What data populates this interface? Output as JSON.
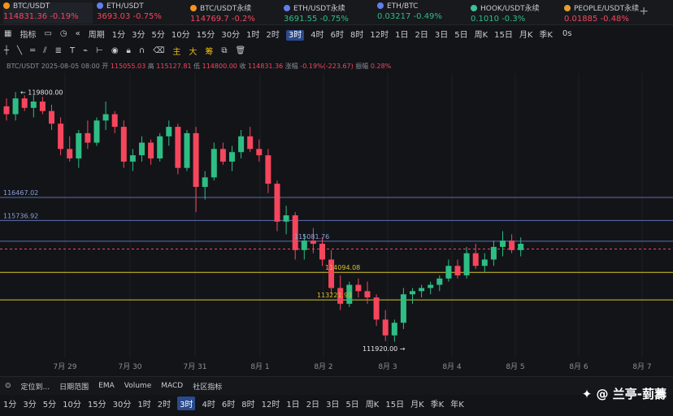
{
  "tickers": [
    {
      "name": "BTC/USDT",
      "price": "114831.36",
      "change": "-0.19%",
      "dir": "dn",
      "color": "#f7931a",
      "active": true
    },
    {
      "name": "ETH/USDT",
      "price": "3693.03",
      "change": "-0.75%",
      "dir": "dn",
      "color": "#627eea"
    },
    {
      "name": "BTC/USDT永续",
      "price": "114769.7",
      "change": "-0.2%",
      "dir": "dn",
      "color": "#f7931a"
    },
    {
      "name": "ETH/USDT永续",
      "price": "3691.55",
      "change": "-0.75%",
      "dir": "up",
      "color": "#627eea"
    },
    {
      "name": "ETH/BTC",
      "price": "0.03217",
      "change": "-0.49%",
      "dir": "up",
      "color": "#627eea"
    },
    {
      "name": "HOOK/USDT永续",
      "price": "0.1010",
      "change": "-0.3%",
      "dir": "up",
      "color": "#3fbfa0"
    },
    {
      "name": "PEOPLE/USDT永续",
      "price": "0.01885",
      "change": "-0.48%",
      "dir": "dn",
      "color": "#e0a030"
    }
  ],
  "toolbar": {
    "indicators": "指标",
    "period": "周期",
    "timeframes": [
      "1分",
      "3分",
      "5分",
      "10分",
      "15分",
      "30分",
      "1时",
      "2时",
      "3时",
      "4时",
      "6时",
      "8时",
      "12时",
      "1日",
      "2日",
      "3日",
      "5日",
      "周K",
      "15日",
      "月K",
      "季K",
      "年K"
    ],
    "selected": "3时",
    "right_label": "0s"
  },
  "draw_tools": {
    "main": "主",
    "big": "大",
    "chip": "筹"
  },
  "info": {
    "symbol": "BTC/USDT",
    "time": "2025-08-05 08:00",
    "open_l": "开",
    "open": "115055.03",
    "high_l": "高",
    "high": "115127.81",
    "low_l": "低",
    "low": "114800.00",
    "close_l": "收",
    "close": "114831.36",
    "chg_l": "涨幅",
    "chg": "-0.19%(-223.67)",
    "amp_l": "振幅",
    "amp": "0.28%"
  },
  "levels": {
    "high_mark": "← 119800.00",
    "l1": "116467.02",
    "l2": "115736.92",
    "l3": "115081.76",
    "l4": "114094.08",
    "l5": "113221.93",
    "low_mark": "111920.00 →"
  },
  "x_labels": [
    "7月 29",
    "7月 30",
    "7月 31",
    "8月 1",
    "8月 2",
    "8月 3",
    "8月 4",
    "8月 5",
    "8月 6",
    "8月 7"
  ],
  "bottom": {
    "locate": "定位到...",
    "range": "日期范围",
    "ema": "EMA",
    "volume": "Volume",
    "macd": "MACD",
    "community": "社区指标"
  },
  "timeframes2": [
    "1分",
    "3分",
    "5分",
    "10分",
    "15分",
    "30分",
    "1时",
    "2时",
    "3时",
    "4时",
    "6时",
    "8时",
    "12时",
    "1日",
    "2日",
    "3日",
    "5日",
    "周K",
    "15日",
    "月K",
    "季K",
    "年K"
  ],
  "selected2": "3时",
  "watermark": "@ 兰亭-菿薵",
  "chart_data": {
    "type": "candlestick",
    "ylim": [
      111400,
      120400
    ],
    "candles": [
      [
        119350,
        119600,
        118900,
        119100
      ],
      [
        119100,
        119800,
        118900,
        119600
      ],
      [
        119600,
        119700,
        119200,
        119300
      ],
      [
        119300,
        119700,
        119000,
        119500
      ],
      [
        119500,
        119650,
        119100,
        119200
      ],
      [
        119200,
        119400,
        118600,
        118800
      ],
      [
        118800,
        119000,
        117800,
        118000
      ],
      [
        118000,
        118400,
        117600,
        117700
      ],
      [
        117700,
        118600,
        117400,
        118500
      ],
      [
        118500,
        118900,
        118000,
        118200
      ],
      [
        118200,
        119000,
        118100,
        118900
      ],
      [
        118900,
        119500,
        118600,
        119100
      ],
      [
        119100,
        119200,
        118500,
        118700
      ],
      [
        118700,
        118900,
        117400,
        117600
      ],
      [
        117600,
        118000,
        117300,
        117800
      ],
      [
        117800,
        118400,
        117600,
        118200
      ],
      [
        118200,
        118300,
        117500,
        117700
      ],
      [
        117700,
        118500,
        117600,
        118400
      ],
      [
        118400,
        118900,
        118100,
        118700
      ],
      [
        118700,
        118800,
        117200,
        117400
      ],
      [
        117400,
        118600,
        117300,
        118500
      ],
      [
        118500,
        118700,
        116000,
        116800
      ],
      [
        116800,
        117300,
        116400,
        117100
      ],
      [
        117100,
        118200,
        117000,
        118000
      ],
      [
        118000,
        118200,
        117500,
        117600
      ],
      [
        117600,
        118100,
        117300,
        117900
      ],
      [
        117900,
        118600,
        117700,
        118400
      ],
      [
        118400,
        118700,
        117900,
        118000
      ],
      [
        118000,
        118300,
        117600,
        117800
      ],
      [
        117800,
        118000,
        116600,
        116900
      ],
      [
        116900,
        117000,
        115400,
        115700
      ],
      [
        115700,
        116200,
        115300,
        115900
      ],
      [
        115900,
        116000,
        114500,
        114800
      ],
      [
        114800,
        115300,
        114500,
        115100
      ],
      [
        115100,
        115500,
        114700,
        115000
      ],
      [
        115000,
        115200,
        114300,
        114500
      ],
      [
        114500,
        114800,
        113400,
        113600
      ],
      [
        113600,
        114000,
        112900,
        113100
      ],
      [
        113100,
        113800,
        113000,
        113700
      ],
      [
        113700,
        113900,
        113300,
        113500
      ],
      [
        113500,
        113800,
        113100,
        113300
      ],
      [
        113300,
        113400,
        112400,
        112600
      ],
      [
        112600,
        112900,
        111920,
        112100
      ],
      [
        112100,
        112600,
        111900,
        112500
      ],
      [
        112500,
        113600,
        112300,
        113400
      ],
      [
        113400,
        113600,
        113100,
        113500
      ],
      [
        113500,
        113700,
        113300,
        113600
      ],
      [
        113600,
        113800,
        113400,
        113700
      ],
      [
        113700,
        114000,
        113500,
        113900
      ],
      [
        113900,
        114500,
        113800,
        114300
      ],
      [
        114300,
        114500,
        113900,
        114000
      ],
      [
        114000,
        114900,
        113900,
        114700
      ],
      [
        114700,
        115000,
        114200,
        114300
      ],
      [
        114300,
        114700,
        114100,
        114500
      ],
      [
        114500,
        115100,
        114300,
        114900
      ],
      [
        114900,
        115400,
        114600,
        115100
      ],
      [
        115100,
        115300,
        114700,
        114800
      ],
      [
        114800,
        115200,
        114600,
        115000
      ]
    ],
    "hlines": [
      {
        "value": 116467.02,
        "color": "#5b6fb0"
      },
      {
        "value": 115736.92,
        "color": "#5b6fb0"
      },
      {
        "value": 115081.76,
        "color": "#5b6fb0"
      },
      {
        "value": 114094.08,
        "color": "#d9c32a"
      },
      {
        "value": 113221.93,
        "color": "#d9c32a"
      },
      {
        "value": 114831.36,
        "color": "#f6465d",
        "dashed": true
      }
    ]
  }
}
